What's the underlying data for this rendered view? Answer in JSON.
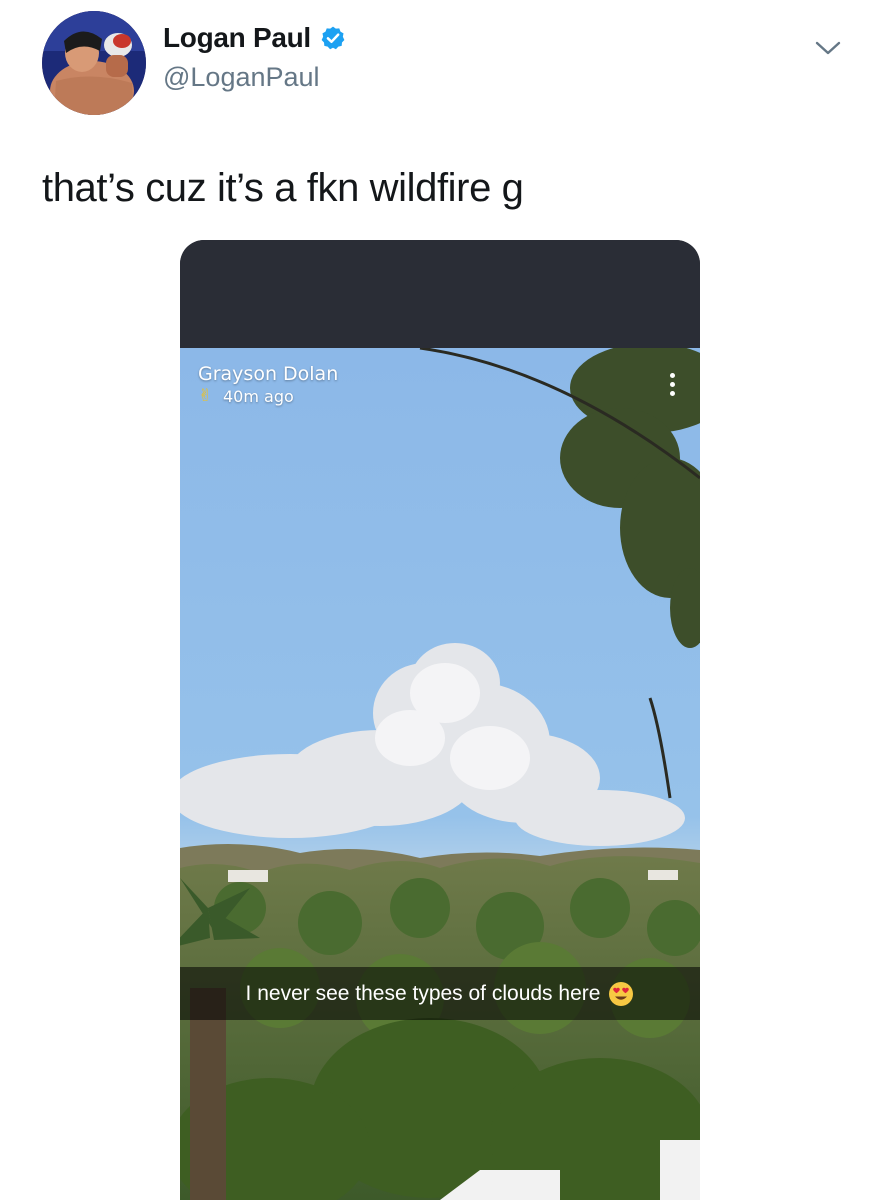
{
  "tweet": {
    "display_name": "Logan Paul",
    "handle": "@LoganPaul",
    "verified": true,
    "text": "that’s cuz it’s a fkn wildfire g",
    "menu_icon": "chevron-down-icon"
  },
  "snap": {
    "username": "Grayson Dolan",
    "time_icon": "victory-hand-icon",
    "time_icon_glyph": "✌",
    "time_ago": "40m ago",
    "caption": "I never see these types of clouds here",
    "caption_emoji": "heart-eyes-icon",
    "menu_icon": "more-vertical-icon"
  },
  "colors": {
    "name": "#14171a",
    "handle": "#657786",
    "verified": "#1da1f2",
    "snap_topbar": "#2a2d36",
    "sky": "#8cb9e6"
  }
}
